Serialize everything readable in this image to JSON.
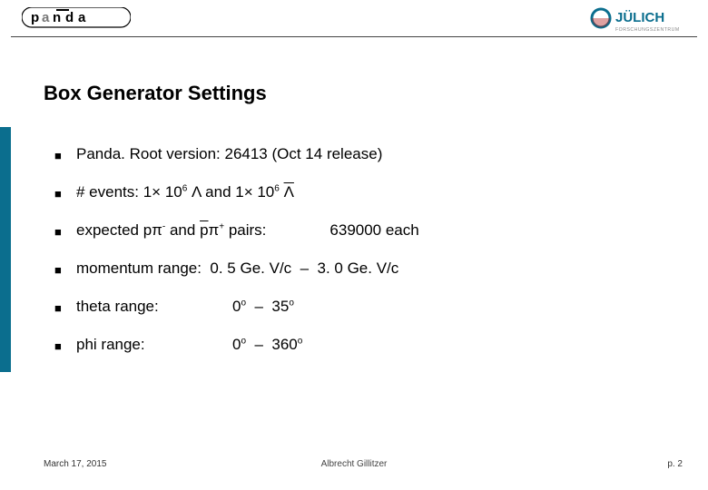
{
  "logos": {
    "left_name": "panda-logo",
    "right_name": "julich-logo",
    "right_word": "JÜLICH",
    "right_sub": "FORSCHUNGSZENTRUM"
  },
  "title": "Box Generator Settings",
  "bullets": {
    "b1": "Panda. Root version: 26413 (Oct 14 release)",
    "b2_pre": "# events: 1× 10",
    "b2_exp1": "6",
    "b2_mid": " Λ and 1× 10",
    "b2_exp2": "6",
    "b2_lambda_bar": "Λ",
    "b3_pre": "expected pπ",
    "b3_minus": "-",
    "b3_mid": " and ",
    "b3_pbar": "p",
    "b3_pi": "π",
    "b3_plus": "+",
    "b3_post": " pairs:",
    "b3_value": "639000 each",
    "b4": "momentum range:  0. 5 Ge. V/c  –  3. 0 Ge. V/c",
    "b5_label": "theta range:",
    "b5_v1": "0",
    "b5_deg1": "o",
    "b5_dash": "  –  ",
    "b5_v2": "35",
    "b5_deg2": "o",
    "b6_label": "phi range:",
    "b6_v1": "0",
    "b6_deg1": "o",
    "b6_dash": "  –  ",
    "b6_v2": "360",
    "b6_deg2": "o"
  },
  "footer": {
    "date": "March 17, 2015",
    "author": "Albrecht Gillitzer",
    "page": "p. 2"
  },
  "colors": {
    "teal": "#0b6e8e"
  }
}
